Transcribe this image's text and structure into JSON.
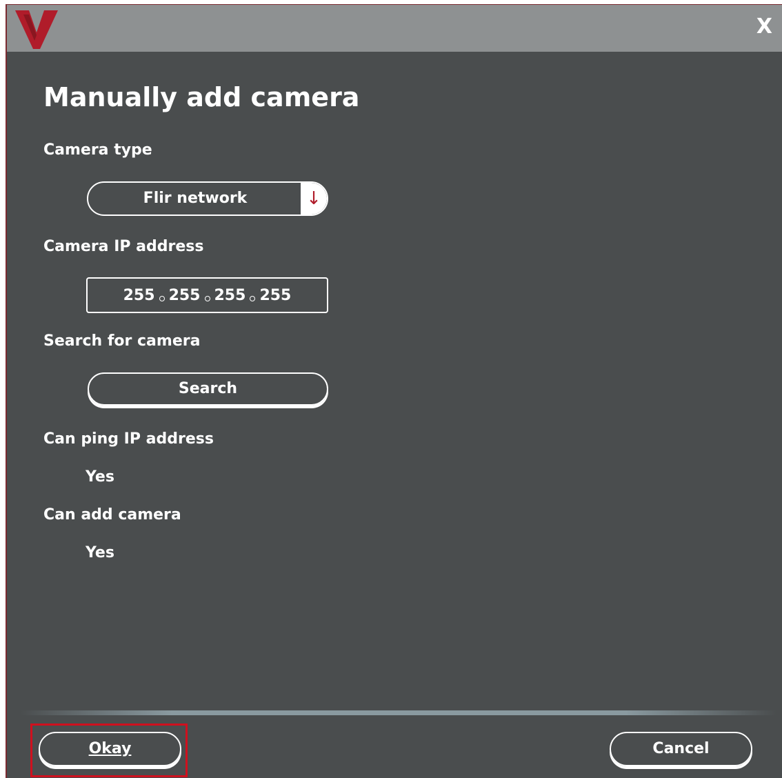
{
  "window": {
    "close_label": "X"
  },
  "title": "Manually add camera",
  "camera_type": {
    "label": "Camera type",
    "selected": "Flir network",
    "arrow": "↓"
  },
  "camera_ip": {
    "label": "Camera IP address",
    "octets": [
      "255",
      "255",
      "255",
      "255"
    ]
  },
  "search": {
    "label": "Search for camera",
    "button_label": "Search"
  },
  "ping": {
    "label": "Can ping IP address",
    "value": "Yes"
  },
  "can_add": {
    "label": "Can add camera",
    "value": "Yes"
  },
  "footer": {
    "okay_label": "Okay",
    "cancel_label": "Cancel"
  },
  "colors": {
    "accent": "#b01c2a",
    "background": "#4a4d4e",
    "titlebar": "#8e9192",
    "highlight": "#d0101e"
  },
  "icons": {
    "logo": "v-logo",
    "dropdown": "arrow-down-icon"
  }
}
